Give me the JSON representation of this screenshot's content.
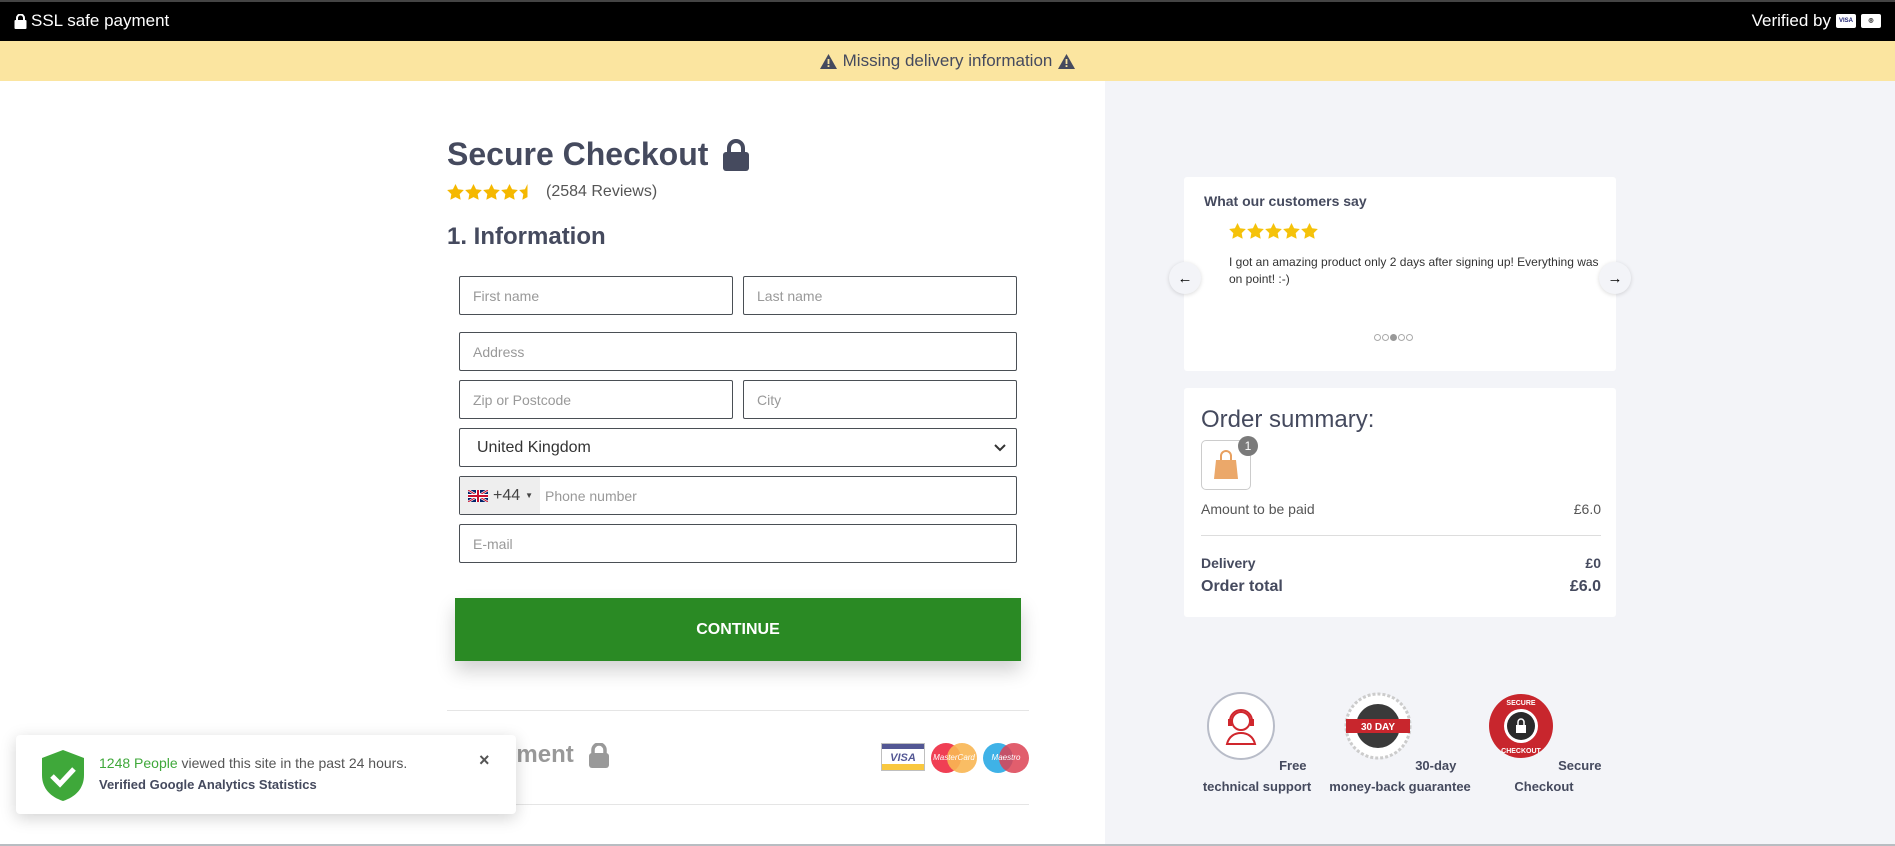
{
  "topbar": {
    "ssl_label": "SSL safe payment",
    "verified_label": "Verified by",
    "verified_logos": [
      "visa",
      "mastercard"
    ]
  },
  "warning": {
    "text": "Missing delivery information",
    "icon": "warning-triangle-icon"
  },
  "checkout": {
    "title": "Secure Checkout",
    "rating": {
      "stars": 4.5,
      "max": 5,
      "reviews_label": "(2584 Reviews)"
    },
    "section_title": "1. Information",
    "fields": {
      "first_name": {
        "placeholder": "First name",
        "value": ""
      },
      "last_name": {
        "placeholder": "Last name",
        "value": ""
      },
      "address": {
        "placeholder": "Address",
        "value": ""
      },
      "zip": {
        "placeholder": "Zip or Postcode",
        "value": ""
      },
      "city": {
        "placeholder": "City",
        "value": ""
      },
      "country": {
        "selected": "United Kingdom"
      },
      "phone": {
        "country_code": "+44",
        "flag": "uk-flag",
        "placeholder": "Phone number",
        "value": ""
      },
      "email": {
        "placeholder": "E-mail",
        "value": ""
      }
    },
    "continue_label": "CONTINUE",
    "payment_section_title": "2. Payment",
    "payment_logos": [
      "VISA",
      "MasterCard",
      "Maestro"
    ]
  },
  "toast": {
    "highlight": "1248 People",
    "text": " viewed this site in the past 24 hours.",
    "subtext": "Verified Google Analytics Statistics",
    "close": "×"
  },
  "reviews": {
    "title": "What our customers say",
    "stars": 5,
    "text": "I got an amazing product only 2 days after signing up! Everything was on point! :-)",
    "dots_total": 5,
    "dots_active": 3,
    "prev": "←",
    "next": "→"
  },
  "order": {
    "title": "Order summary:",
    "item_count": "1",
    "amount_label": "Amount to be paid",
    "amount_value": "£6.0",
    "delivery_label": "Delivery",
    "delivery_value": "£0",
    "total_label": "Order total",
    "total_value": "£6.0"
  },
  "trust": [
    {
      "label": "Free technical support",
      "icon": "headset-support-icon"
    },
    {
      "label": "30-day money-back guarantee",
      "icon": "money-back-badge-icon",
      "badge_text": "30 DAY"
    },
    {
      "label": "Secure Checkout",
      "icon": "secure-checkout-badge-icon"
    }
  ],
  "colors": {
    "accent_green": "#2a8a24",
    "warning_bg": "#fbe5a0",
    "star": "#f5c20a",
    "panel_bg": "#f3f4f8"
  }
}
